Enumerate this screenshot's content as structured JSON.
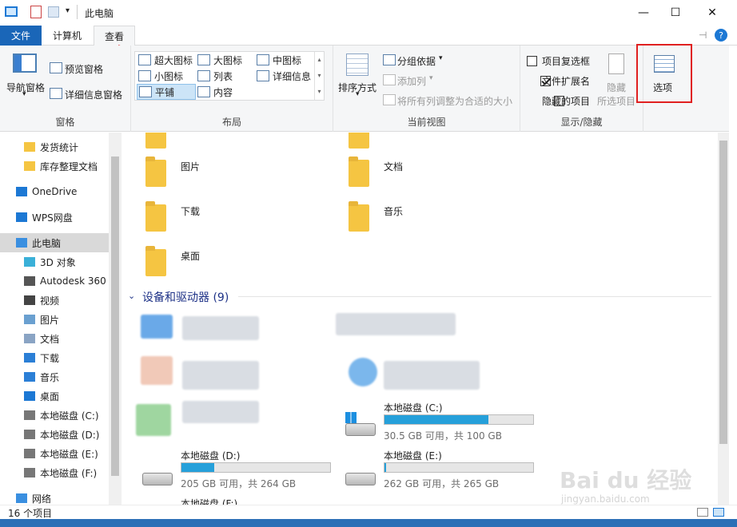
{
  "window": {
    "title": "此电脑"
  },
  "tabs": {
    "file": "文件",
    "computer": "计算机",
    "view": "查看"
  },
  "ribbon": {
    "panes": {
      "nav_pane": "导航窗格",
      "preview_pane": "预览窗格",
      "details_pane": "详细信息窗格",
      "group": "窗格"
    },
    "layout": {
      "items": [
        "超大图标",
        "大图标",
        "中图标",
        "小图标",
        "列表",
        "详细信息",
        "平铺",
        "内容"
      ],
      "selected": "平铺",
      "group": "布局"
    },
    "current_view": {
      "sort_by": "排序方式",
      "group_by": "分组依据",
      "add_columns": "添加列",
      "size_all_columns": "将所有列调整为合适的大小",
      "group": "当前视图"
    },
    "show_hide": {
      "item_checkboxes": {
        "label": "项目复选框",
        "checked": false
      },
      "file_extensions": {
        "label": "文件扩展名",
        "checked": true
      },
      "hidden_items": {
        "label": "隐藏的项目",
        "checked": false
      },
      "hide_selected": "隐藏\n所选项目",
      "hide_selected_line1": "隐藏",
      "hide_selected_line2": "所选项目",
      "group": "显示/隐藏"
    },
    "options": "选项"
  },
  "nav": {
    "items": [
      {
        "label": "发货统计",
        "icon": "folder-icon"
      },
      {
        "label": "库存整理文档",
        "icon": "folder-icon"
      },
      {
        "label": "OneDrive",
        "icon": "cloud-icon"
      },
      {
        "label": "WPS网盘",
        "icon": "cloud-icon"
      },
      {
        "label": "此电脑",
        "icon": "computer-icon"
      },
      {
        "label": "3D 对象",
        "icon": "cube-icon"
      },
      {
        "label": "Autodesk 360",
        "icon": "autodesk-icon"
      },
      {
        "label": "视频",
        "icon": "video-icon"
      },
      {
        "label": "图片",
        "icon": "picture-icon"
      },
      {
        "label": "文档",
        "icon": "document-icon"
      },
      {
        "label": "下载",
        "icon": "download-icon"
      },
      {
        "label": "音乐",
        "icon": "music-icon"
      },
      {
        "label": "桌面",
        "icon": "desktop-icon"
      },
      {
        "label": "本地磁盘 (C:)",
        "icon": "drive-icon"
      },
      {
        "label": "本地磁盘 (D:)",
        "icon": "drive-icon"
      },
      {
        "label": "本地磁盘 (E:)",
        "icon": "drive-icon"
      },
      {
        "label": "本地磁盘 (F:)",
        "icon": "drive-icon"
      },
      {
        "label": "网络",
        "icon": "network-icon"
      }
    ],
    "selected": "此电脑"
  },
  "folders": [
    "图片",
    "文档",
    "下载",
    "音乐",
    "桌面"
  ],
  "devices": {
    "header": "设备和驱动器 (9)",
    "drives": [
      {
        "name": "本地磁盘 (C:)",
        "free": "30.5 GB 可用，共 100 GB",
        "used_fraction": 0.7
      },
      {
        "name": "本地磁盘 (D:)",
        "free": "205 GB 可用，共 264 GB",
        "used_fraction": 0.22
      },
      {
        "name": "本地磁盘 (E:)",
        "free": "262 GB 可用，共 265 GB",
        "used_fraction": 0.01
      },
      {
        "name": "本地磁盘 (F:)",
        "free": ""
      }
    ]
  },
  "status": {
    "count": "16 个项目"
  },
  "watermark": {
    "main": "Bai du 经验",
    "sub": "jingyan.baidu.com"
  }
}
